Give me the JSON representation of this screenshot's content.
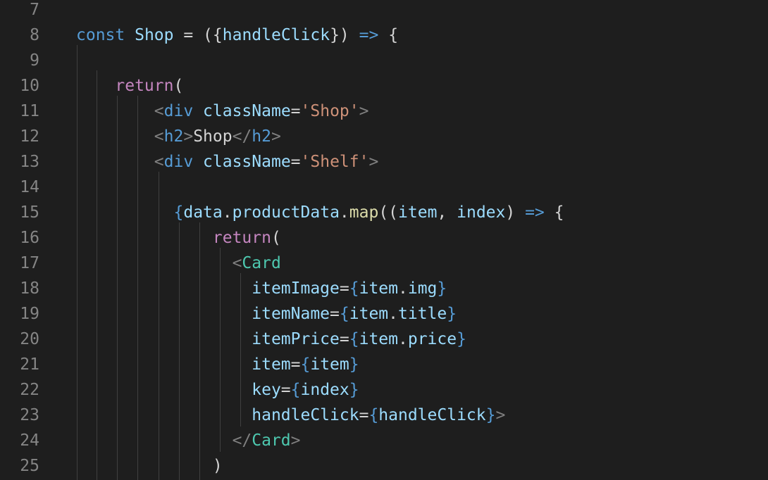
{
  "editor": {
    "lines": [
      {
        "n": "7",
        "tokens": []
      },
      {
        "n": "8",
        "tokens": [
          {
            "t": "const",
            "c": "kw"
          },
          {
            "t": " ",
            "c": "txt"
          },
          {
            "t": "Shop",
            "c": "var"
          },
          {
            "t": " = ",
            "c": "txt"
          },
          {
            "t": "({",
            "c": "txt"
          },
          {
            "t": "handleClick",
            "c": "var"
          },
          {
            "t": "})",
            "c": "txt"
          },
          {
            "t": " ",
            "c": "txt"
          },
          {
            "t": "=>",
            "c": "kw"
          },
          {
            "t": " {",
            "c": "txt"
          }
        ]
      },
      {
        "n": "9",
        "tokens": []
      },
      {
        "n": "10",
        "tokens": [
          {
            "t": "    ",
            "c": "txt"
          },
          {
            "t": "return",
            "c": "ctl"
          },
          {
            "t": "(",
            "c": "txt"
          }
        ]
      },
      {
        "n": "11",
        "tokens": [
          {
            "t": "        ",
            "c": "txt"
          },
          {
            "t": "<",
            "c": "br"
          },
          {
            "t": "div",
            "c": "tag"
          },
          {
            "t": " ",
            "c": "txt"
          },
          {
            "t": "className",
            "c": "attr"
          },
          {
            "t": "=",
            "c": "txt"
          },
          {
            "t": "'Shop'",
            "c": "str"
          },
          {
            "t": ">",
            "c": "br"
          }
        ]
      },
      {
        "n": "12",
        "tokens": [
          {
            "t": "        ",
            "c": "txt"
          },
          {
            "t": "<",
            "c": "br"
          },
          {
            "t": "h2",
            "c": "tag"
          },
          {
            "t": ">",
            "c": "br"
          },
          {
            "t": "Shop",
            "c": "txt"
          },
          {
            "t": "</",
            "c": "br"
          },
          {
            "t": "h2",
            "c": "tag"
          },
          {
            "t": ">",
            "c": "br"
          }
        ]
      },
      {
        "n": "13",
        "tokens": [
          {
            "t": "        ",
            "c": "txt"
          },
          {
            "t": "<",
            "c": "br"
          },
          {
            "t": "div",
            "c": "tag"
          },
          {
            "t": " ",
            "c": "txt"
          },
          {
            "t": "className",
            "c": "attr"
          },
          {
            "t": "=",
            "c": "txt"
          },
          {
            "t": "'Shelf'",
            "c": "str"
          },
          {
            "t": ">",
            "c": "br"
          }
        ]
      },
      {
        "n": "14",
        "tokens": []
      },
      {
        "n": "15",
        "tokens": [
          {
            "t": "          ",
            "c": "txt"
          },
          {
            "t": "{",
            "c": "kw"
          },
          {
            "t": "data",
            "c": "var"
          },
          {
            "t": ".",
            "c": "txt"
          },
          {
            "t": "productData",
            "c": "var"
          },
          {
            "t": ".",
            "c": "txt"
          },
          {
            "t": "map",
            "c": "fn"
          },
          {
            "t": "((",
            "c": "txt"
          },
          {
            "t": "item",
            "c": "var"
          },
          {
            "t": ", ",
            "c": "txt"
          },
          {
            "t": "index",
            "c": "var"
          },
          {
            "t": ") ",
            "c": "txt"
          },
          {
            "t": "=>",
            "c": "kw"
          },
          {
            "t": " {",
            "c": "txt"
          }
        ]
      },
      {
        "n": "16",
        "tokens": [
          {
            "t": "              ",
            "c": "txt"
          },
          {
            "t": "return",
            "c": "ctl"
          },
          {
            "t": "(",
            "c": "txt"
          }
        ]
      },
      {
        "n": "17",
        "tokens": [
          {
            "t": "                ",
            "c": "txt"
          },
          {
            "t": "<",
            "c": "br"
          },
          {
            "t": "Card",
            "c": "comp"
          }
        ]
      },
      {
        "n": "18",
        "tokens": [
          {
            "t": "                  ",
            "c": "txt"
          },
          {
            "t": "itemImage",
            "c": "attr"
          },
          {
            "t": "=",
            "c": "txt"
          },
          {
            "t": "{",
            "c": "kw"
          },
          {
            "t": "item",
            "c": "var"
          },
          {
            "t": ".",
            "c": "txt"
          },
          {
            "t": "img",
            "c": "var"
          },
          {
            "t": "}",
            "c": "kw"
          }
        ]
      },
      {
        "n": "19",
        "tokens": [
          {
            "t": "                  ",
            "c": "txt"
          },
          {
            "t": "itemName",
            "c": "attr"
          },
          {
            "t": "=",
            "c": "txt"
          },
          {
            "t": "{",
            "c": "kw"
          },
          {
            "t": "item",
            "c": "var"
          },
          {
            "t": ".",
            "c": "txt"
          },
          {
            "t": "title",
            "c": "var"
          },
          {
            "t": "}",
            "c": "kw"
          }
        ]
      },
      {
        "n": "20",
        "tokens": [
          {
            "t": "                  ",
            "c": "txt"
          },
          {
            "t": "itemPrice",
            "c": "attr"
          },
          {
            "t": "=",
            "c": "txt"
          },
          {
            "t": "{",
            "c": "kw"
          },
          {
            "t": "item",
            "c": "var"
          },
          {
            "t": ".",
            "c": "txt"
          },
          {
            "t": "price",
            "c": "var"
          },
          {
            "t": "}",
            "c": "kw"
          }
        ]
      },
      {
        "n": "21",
        "tokens": [
          {
            "t": "                  ",
            "c": "txt"
          },
          {
            "t": "item",
            "c": "attr"
          },
          {
            "t": "=",
            "c": "txt"
          },
          {
            "t": "{",
            "c": "kw"
          },
          {
            "t": "item",
            "c": "var"
          },
          {
            "t": "}",
            "c": "kw"
          }
        ]
      },
      {
        "n": "22",
        "tokens": [
          {
            "t": "                  ",
            "c": "txt"
          },
          {
            "t": "key",
            "c": "attr"
          },
          {
            "t": "=",
            "c": "txt"
          },
          {
            "t": "{",
            "c": "kw"
          },
          {
            "t": "index",
            "c": "var"
          },
          {
            "t": "}",
            "c": "kw"
          }
        ]
      },
      {
        "n": "23",
        "tokens": [
          {
            "t": "                  ",
            "c": "txt"
          },
          {
            "t": "handleClick",
            "c": "attr"
          },
          {
            "t": "=",
            "c": "txt"
          },
          {
            "t": "{",
            "c": "kw"
          },
          {
            "t": "handleClick",
            "c": "var"
          },
          {
            "t": "}",
            "c": "kw"
          },
          {
            "t": ">",
            "c": "br"
          }
        ]
      },
      {
        "n": "24",
        "tokens": [
          {
            "t": "                ",
            "c": "txt"
          },
          {
            "t": "</",
            "c": "br"
          },
          {
            "t": "Card",
            "c": "comp"
          },
          {
            "t": ">",
            "c": "br"
          }
        ]
      },
      {
        "n": "25",
        "tokens": [
          {
            "t": "              ",
            "c": "txt"
          },
          {
            "t": ")",
            "c": "txt"
          }
        ]
      }
    ]
  }
}
